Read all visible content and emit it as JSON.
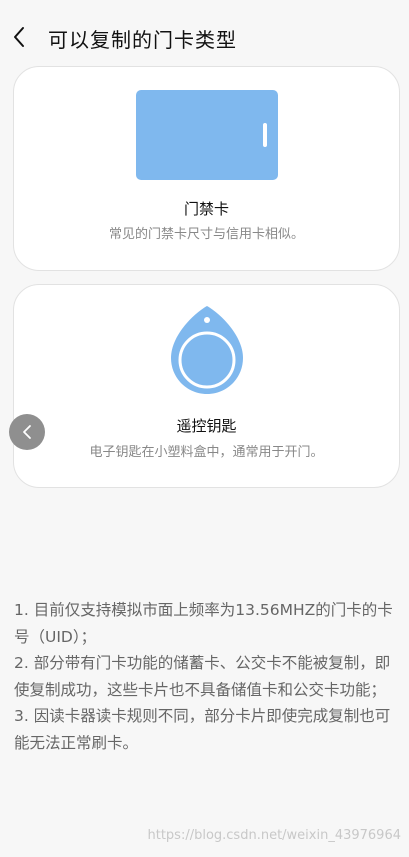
{
  "header": {
    "title": "可以复制的门卡类型",
    "back_icon": "chevron-left-icon"
  },
  "cards": [
    {
      "name": "门禁卡",
      "description": "常见的门禁卡尺寸与信用卡相似。",
      "icon": "access-card-icon",
      "color": "#7fb8ee"
    },
    {
      "name": "遥控钥匙",
      "description": "电子钥匙在小塑料盒中，通常用于开门。",
      "icon": "key-fob-icon",
      "color": "#7fb8ee"
    }
  ],
  "notes": [
    "1. 目前仅支持模拟市面上频率为13.56MHZ的门卡的卡号（UID）；",
    "2. 部分带有门卡功能的储蓄卡、公交卡不能被复制，即使复制成功，这些卡片也不具备储值卡和公交卡功能；",
    "3. 因读卡器读卡规则不同，部分卡片即使完成复制也可能无法正常刷卡。"
  ],
  "floating_button_icon": "chevron-left-icon",
  "watermark": "https://blog.csdn.net/weixin_43976964"
}
